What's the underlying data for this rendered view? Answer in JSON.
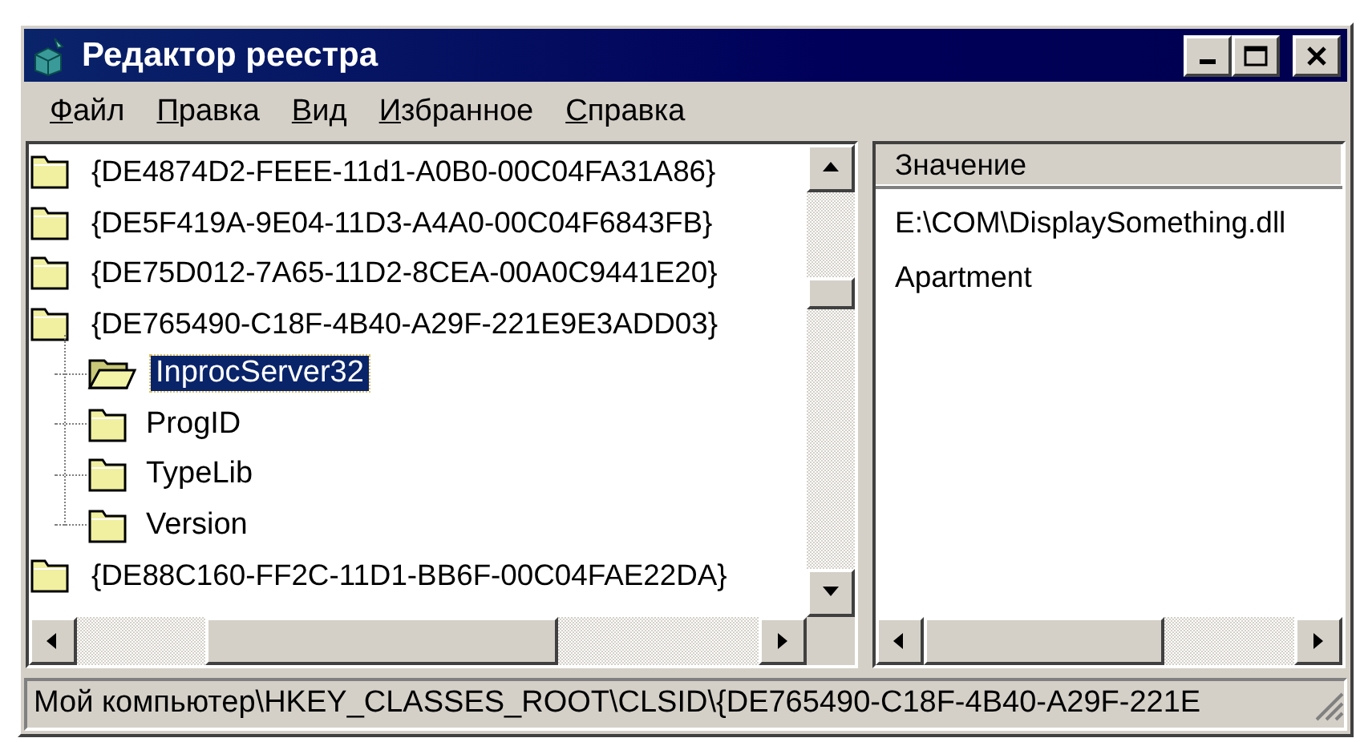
{
  "window": {
    "title": "Редактор реестра"
  },
  "menu": [
    "Файл",
    "Правка",
    "Вид",
    "Избранное",
    "Справка"
  ],
  "tree": [
    {
      "label": "{DE4874D2-FEEE-11d1-A0B0-00C04FA31A86}",
      "selected": false
    },
    {
      "label": "{DE5F419A-9E04-11D3-A4A0-00C04F6843FB}",
      "selected": false
    },
    {
      "label": "{DE75D012-7A65-11D2-8CEA-00A0C9441E20}",
      "selected": false
    },
    {
      "label": "{DE765490-C18F-4B40-A29F-221E9E3ADD03}",
      "selected": false,
      "children": [
        {
          "label": "InprocServer32",
          "selected": true
        },
        {
          "label": "ProgID",
          "selected": false
        },
        {
          "label": "TypeLib",
          "selected": false
        },
        {
          "label": "Version",
          "selected": false
        }
      ]
    },
    {
      "label": "{DE88C160-FF2C-11D1-BB6F-00C04FAE22DA}",
      "selected": false
    }
  ],
  "values": {
    "header": "Значение",
    "rows": [
      "E:\\COM\\DisplaySomething.dll",
      "Apartment"
    ]
  },
  "status_bar": "Мой компьютер\\HKEY_CLASSES_ROOT\\CLSID\\{DE765490-C18F-4B40-A29F-221E"
}
